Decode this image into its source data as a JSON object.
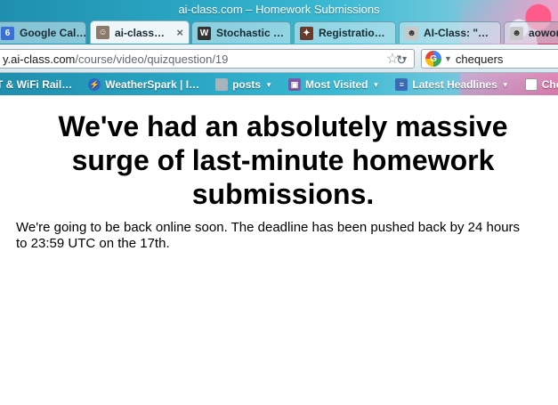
{
  "window": {
    "title": "ai-class.com – Homework Submissions"
  },
  "tabs": [
    {
      "label": "Google Cal…",
      "icon": "calendar-icon",
      "color": "#3a6fd8",
      "glyph": "6"
    },
    {
      "label": "ai-class…",
      "icon": "robot-face-icon",
      "color": "#8a7a6a",
      "glyph": "☺",
      "close": "×"
    },
    {
      "label": "Stochastic …",
      "icon": "wikipedia-icon",
      "color": "#333333",
      "glyph": "W"
    },
    {
      "label": "Registratio…",
      "icon": "registration-icon",
      "color": "#6a3a2a",
      "glyph": "✦"
    },
    {
      "label": "AI-Class: \"…",
      "icon": "reddit-icon",
      "color": "#c8c8c8",
      "glyph": "☻"
    },
    {
      "label": "aowor",
      "icon": "reddit-icon",
      "color": "#c8c8c8",
      "glyph": "☻"
    }
  ],
  "toolbar": {
    "url_host": "y.ai-class.com",
    "url_path": "/course/video/quizquestion/19",
    "star": "☆",
    "reload": "↻",
    "search_value": "chequers",
    "search_engine": "G"
  },
  "bookmarks": [
    {
      "label": "T & WiFi Rail…",
      "icon": "rail-icon",
      "color": "#2a6a8a",
      "glyph": "",
      "caret": ""
    },
    {
      "label": "WeatherSpark | I…",
      "icon": "lightning-icon",
      "color": "#2f67c8",
      "glyph": "⚡",
      "caret": ""
    },
    {
      "label": "posts",
      "icon": "folder-icon",
      "color": "#a8b4bb",
      "glyph": "",
      "caret": "▼"
    },
    {
      "label": "Most Visited",
      "icon": "most-visited-icon",
      "color": "#7a5aa8",
      "glyph": "▣",
      "caret": "▼"
    },
    {
      "label": "Latest Headlines",
      "icon": "rss-icon",
      "color": "#3a6ab8",
      "glyph": "≡",
      "caret": "▼"
    },
    {
      "label": "Chec",
      "icon": "page-icon",
      "color": "#ffffff",
      "glyph": "",
      "caret": ""
    }
  ],
  "page": {
    "headline": "We've had an absolutely massive surge of last-minute homework submissions.",
    "message": "We're going to be back online soon. The deadline has been pushed back by 24 hours to 23:59 UTC on the 17th."
  }
}
